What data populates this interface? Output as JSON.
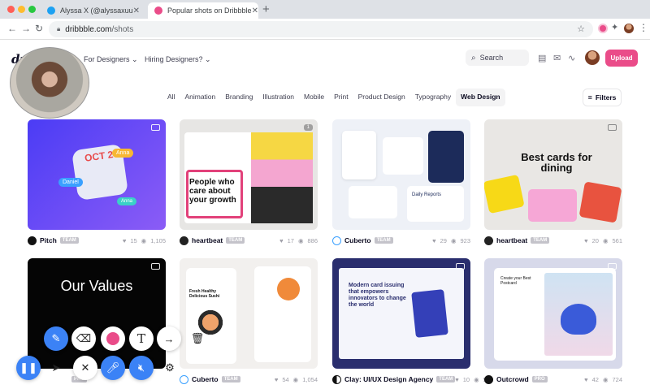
{
  "browser": {
    "tabs": [
      {
        "title": "Alyssa X (@alyssaxuu) / Twitter",
        "active": false
      },
      {
        "title": "Popular shots on Dribbble",
        "active": true
      }
    ],
    "url_domain": "dribbble.com",
    "url_path": "/shots"
  },
  "header": {
    "logo": "dri",
    "nav": [
      "For Designers",
      "Hiring Designers?"
    ],
    "search_placeholder": "Search",
    "upload_label": "Upload"
  },
  "categories": [
    "All",
    "Animation",
    "Branding",
    "Illustration",
    "Mobile",
    "Print",
    "Product Design",
    "Typography",
    "Web Design"
  ],
  "active_category": "Web Design",
  "filters_label": "Filters",
  "shots": [
    {
      "author": "Pitch",
      "tag": "TEAM",
      "likes": "15",
      "views": "1,105",
      "text": "OCT 20",
      "bubbles": [
        "Anna",
        "Daniel",
        "Anna"
      ]
    },
    {
      "author": "heartbeat",
      "tag": "TEAM",
      "likes": "17",
      "views": "886",
      "text": "People who care about your growth",
      "badge_count": "1"
    },
    {
      "author": "Cuberto",
      "tag": "TEAM",
      "likes": "29",
      "views": "923",
      "text": "Daily Reports"
    },
    {
      "author": "heartbeat",
      "tag": "TEAM",
      "likes": "20",
      "views": "561",
      "text": "Best cards for dining"
    },
    {
      "author": "",
      "tag": "PRO",
      "likes": "",
      "views": "",
      "text": "Our Values"
    },
    {
      "author": "Cuberto",
      "tag": "TEAM",
      "likes": "54",
      "views": "1,054",
      "text": "Fresh Healthy Delicious Sushi"
    },
    {
      "author": "Clay: UI/UX Design Agency",
      "tag": "TEAM",
      "likes": "10",
      "views": "522",
      "text": "Modern card issuing that empowers innovators to change the world"
    },
    {
      "author": "Outcrowd",
      "tag": "PRO",
      "likes": "42",
      "views": "724",
      "text": "Create your Best Postcard"
    }
  ],
  "colors": {
    "accent": "#ea4c89",
    "tool_blue": "#3b82f6"
  }
}
